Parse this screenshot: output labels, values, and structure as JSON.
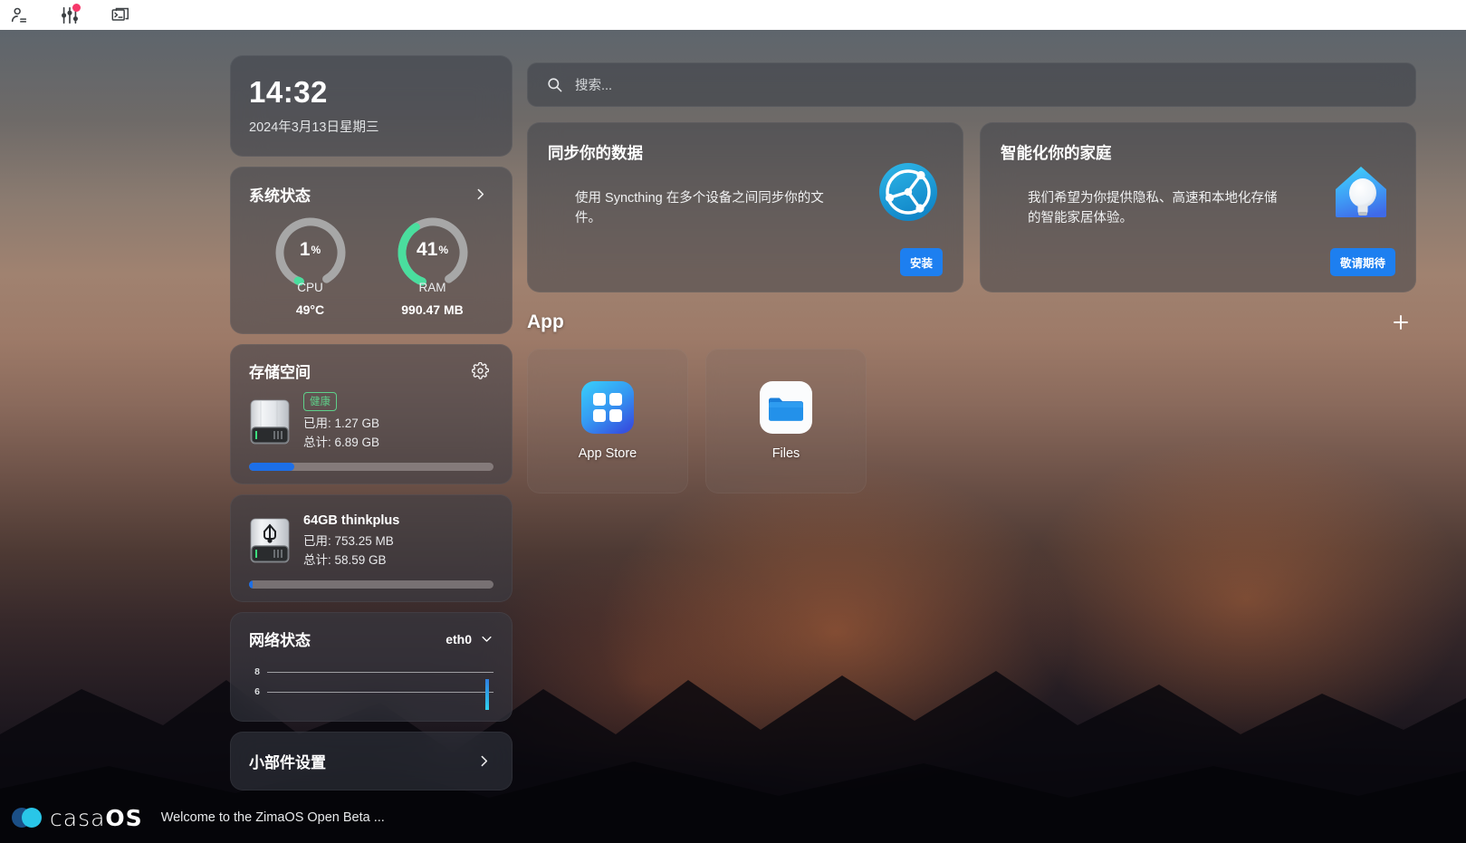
{
  "browser_bar": {
    "icons": [
      {
        "name": "account-icon",
        "glyph": "person"
      },
      {
        "name": "sliders-icon",
        "glyph": "sliders",
        "badge": true
      },
      {
        "name": "terminal-icon",
        "glyph": "terminal"
      }
    ]
  },
  "clock": {
    "time": "14:32",
    "date": "2024年3月13日星期三"
  },
  "system_status": {
    "title": "系统状态",
    "chevron": "chevron-right-icon",
    "gauges": [
      {
        "label": "CPU",
        "value": "1",
        "unit": "%",
        "percent": 1,
        "sub": "49°C",
        "color": "#4ade9e"
      },
      {
        "label": "RAM",
        "value": "41",
        "unit": "%",
        "percent": 41,
        "sub": "990.47 MB",
        "color": "#4ade9e"
      }
    ]
  },
  "storage": {
    "title": "存储空间",
    "settings_icon": "gear-icon",
    "disk": {
      "icon": "hard-drive-icon",
      "health_badge": "健康",
      "used_label": "已用: 1.27 GB",
      "total_label": "总计: 6.89 GB",
      "used_percent": 18.4,
      "bar_color": "#1c6fe8"
    }
  },
  "usb": {
    "icon": "usb-drive-icon",
    "name": "64GB thinkplus",
    "used_label": "已用: 753.25 MB",
    "total_label": "总计: 58.59 GB",
    "used_percent": 1.3,
    "bar_color": "#1c6fe8"
  },
  "network": {
    "title": "网络状态",
    "interface": "eth0",
    "dropdown_icon": "chevron-down-icon",
    "chart": {
      "y_labels": [
        "8",
        "6"
      ],
      "bar_color": "#30c4ec"
    }
  },
  "widget_settings": {
    "title": "小部件设置",
    "chevron": "chevron-right-icon"
  },
  "search": {
    "placeholder": "搜索...",
    "icon": "search-icon",
    "value": ""
  },
  "promos": [
    {
      "title": "同步你的数据",
      "body": "使用 Syncthing 在多个设备之间同步你的文件。",
      "logo": "syncthing-logo",
      "button": "安装",
      "button_color": "#1d7ff0"
    },
    {
      "title": "智能化你的家庭",
      "body": "我们希望为你提供隐私、高速和本地化存储的智能家居体验。",
      "logo": "smart-home-icon",
      "button": "敬请期待",
      "button_color": "#1d7ff0"
    }
  ],
  "apps": {
    "section_title": "App",
    "add_icon": "plus-icon",
    "items": [
      {
        "label": "App Store",
        "icon": "app-store-icon"
      },
      {
        "label": "Files",
        "icon": "files-folder-icon"
      }
    ]
  },
  "bottom": {
    "logo_light": "casa",
    "logo_bold": "OS",
    "message": "Welcome to the ZimaOS Open Beta ..."
  }
}
